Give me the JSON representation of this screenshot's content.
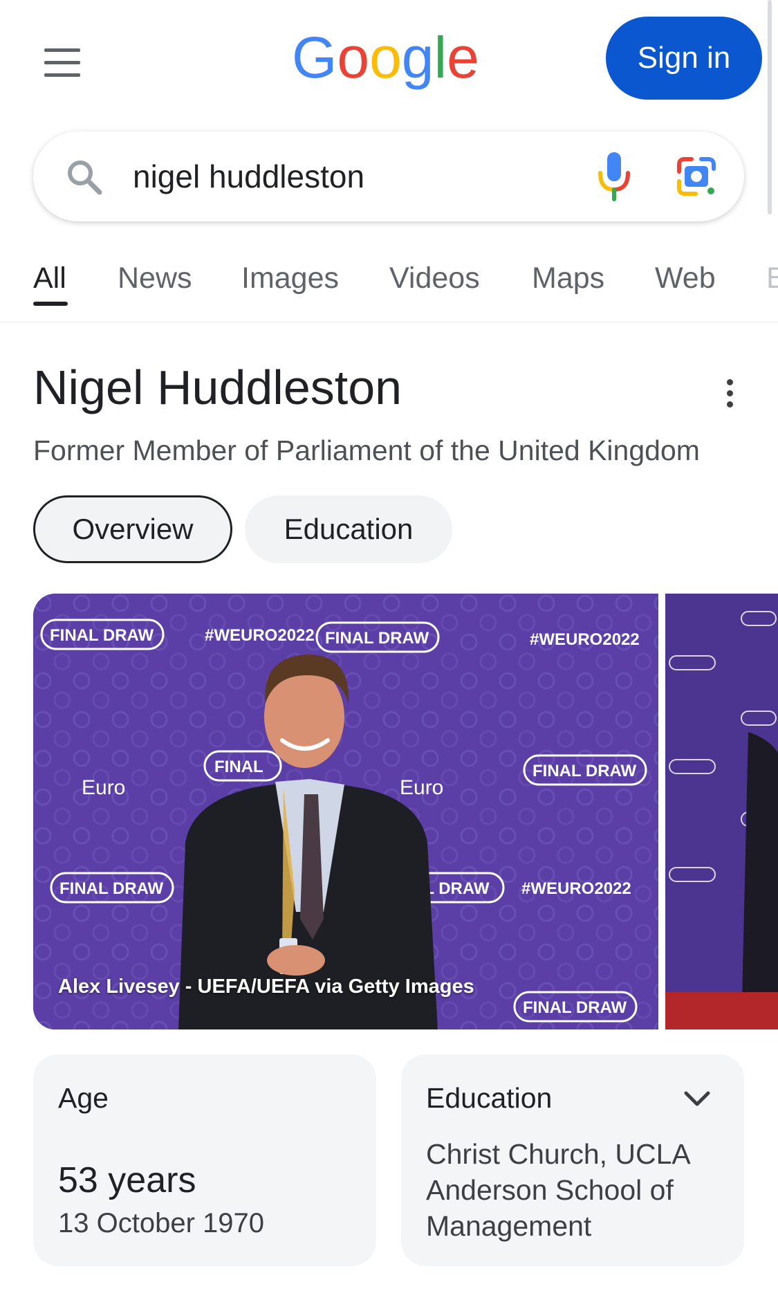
{
  "header": {
    "logo_text": "Google",
    "signin_label": "Sign in"
  },
  "search": {
    "query": "nigel huddleston"
  },
  "tabs": [
    {
      "label": "All",
      "active": true
    },
    {
      "label": "News"
    },
    {
      "label": "Images"
    },
    {
      "label": "Videos"
    },
    {
      "label": "Maps"
    },
    {
      "label": "Web"
    },
    {
      "label": "B"
    }
  ],
  "knowledge_panel": {
    "title": "Nigel Huddleston",
    "subtitle": "Former Member of Parliament of the United Kingdom",
    "chips": [
      "Overview",
      "Education"
    ],
    "photo": {
      "credit": "Alex Livesey - UEFA/UEFA via Getty Images",
      "backdrop_texts": [
        "FINAL DRAW",
        "#WEURO2022",
        "FINAL DRAW",
        "#WEURO2022",
        "FINAL",
        "FINAL DRAW",
        "FINAL DRAW",
        "AL DRAW",
        "#WEURO2022",
        "FINAL DRAW"
      ],
      "logo_text": "Euro"
    },
    "age": {
      "label": "Age",
      "value": "53 years",
      "date": "13 October 1970"
    },
    "education": {
      "label": "Education",
      "value": "Christ Church, UCLA Anderson School of Management"
    }
  },
  "colors": {
    "accent_blue": "#0b57d0",
    "google_blue": "#4285f4",
    "google_red": "#ea4335",
    "google_yellow": "#fbbc05",
    "google_green": "#34a853",
    "photo_backdrop": "#5b3fa6"
  },
  "icons": [
    "hamburger-menu-icon",
    "search-icon",
    "microphone-icon",
    "google-lens-icon",
    "more-vert-icon",
    "chevron-down-icon"
  ]
}
